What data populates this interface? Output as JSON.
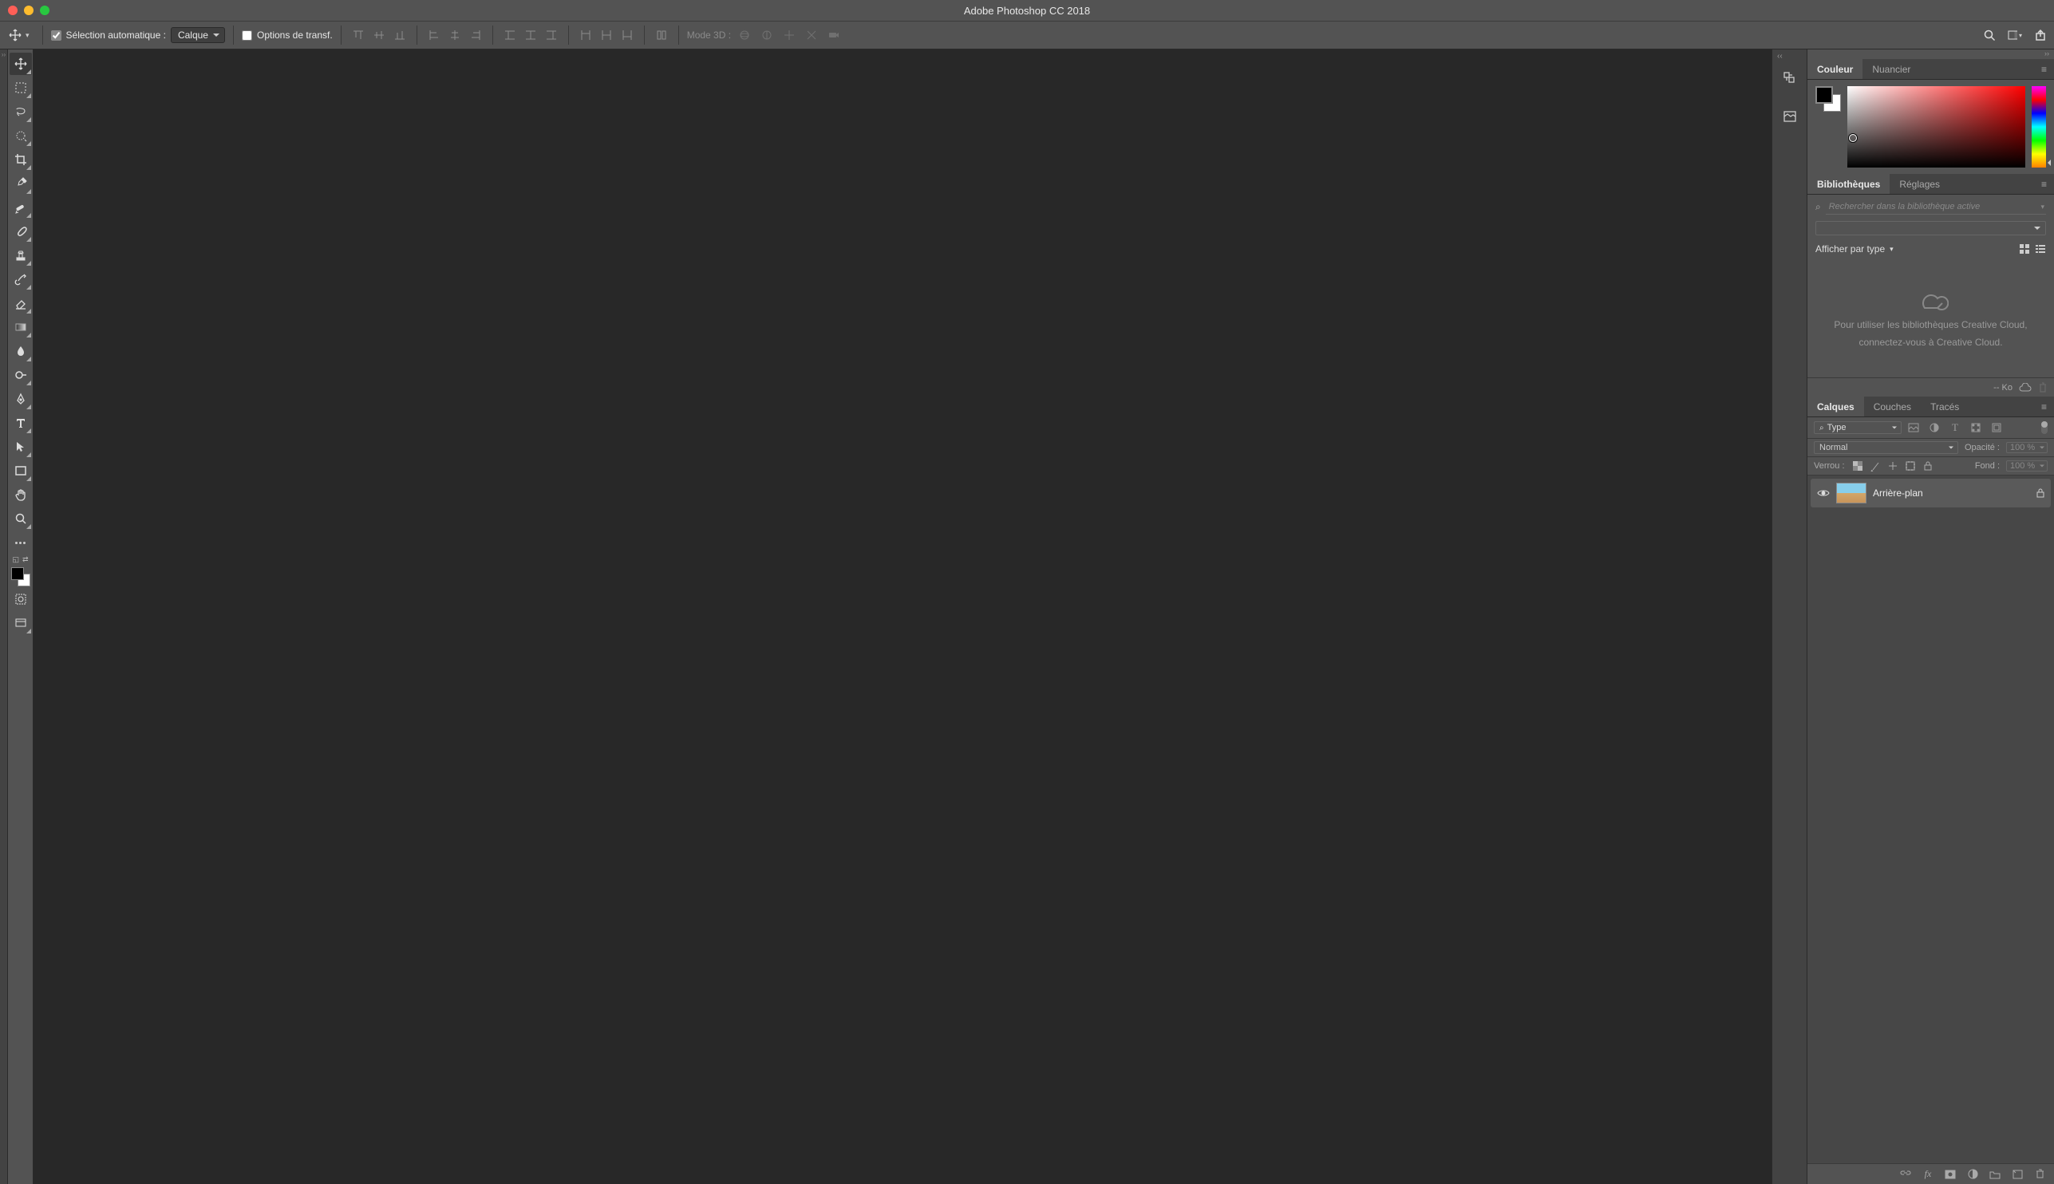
{
  "app": {
    "title": "Adobe Photoshop CC 2018"
  },
  "options": {
    "selection_auto_label": "Sélection automatique :",
    "selection_auto_checked": true,
    "select_target": "Calque",
    "transform_opts_label": "Options de transf.",
    "mode3d_label": "Mode 3D :"
  },
  "panels": {
    "color": {
      "tab_active": "Couleur",
      "tab_inactive": "Nuancier"
    },
    "libraries": {
      "tab_active": "Bibliothèques",
      "tab_inactive": "Réglages",
      "search_placeholder": "Rechercher dans la bibliothèque active",
      "display_by_type": "Afficher par type",
      "placeholder_line1": "Pour utiliser les bibliothèques Creative Cloud,",
      "placeholder_line2": "connectez-vous à Creative Cloud.",
      "size_label": "-- Ko"
    },
    "layers": {
      "tabs": [
        "Calques",
        "Couches",
        "Tracés"
      ],
      "filter_type": "Type",
      "blend_mode": "Normal",
      "opacity_label": "Opacité :",
      "opacity_value": "100 %",
      "lock_label": "Verrou :",
      "fill_label": "Fond :",
      "fill_value": "100 %",
      "layer0_name": "Arrière-plan"
    }
  },
  "tools": [
    {
      "name": "move-tool"
    },
    {
      "name": "marquee-tool"
    },
    {
      "name": "lasso-tool"
    },
    {
      "name": "quick-selection-tool"
    },
    {
      "name": "crop-tool"
    },
    {
      "name": "eyedropper-tool"
    },
    {
      "name": "healing-brush-tool"
    },
    {
      "name": "brush-tool"
    },
    {
      "name": "clone-stamp-tool"
    },
    {
      "name": "history-brush-tool"
    },
    {
      "name": "eraser-tool"
    },
    {
      "name": "gradient-tool"
    },
    {
      "name": "blur-tool"
    },
    {
      "name": "dodge-tool"
    },
    {
      "name": "pen-tool"
    },
    {
      "name": "type-tool"
    },
    {
      "name": "path-selection-tool"
    },
    {
      "name": "rectangle-tool"
    },
    {
      "name": "hand-tool"
    },
    {
      "name": "zoom-tool"
    }
  ]
}
